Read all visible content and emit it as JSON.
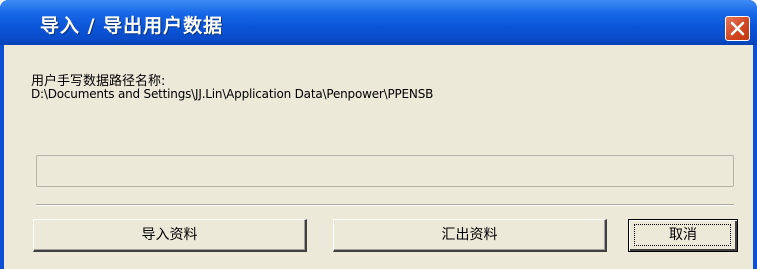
{
  "window": {
    "title": "导入 / 导出用户数据",
    "close_icon": "close-icon"
  },
  "content": {
    "path_label": "用户手写数据路径名称:",
    "path_value": "D:\\Documents and Settings\\JJ.Lin\\Application Data\\Penpower\\PPENSB",
    "progress_fraction": 0
  },
  "buttons": {
    "import_label": "导入资料",
    "export_label": "汇出资料",
    "cancel_label": "取消"
  },
  "colors": {
    "titlebar": "#0b55d8",
    "client_bg": "#ece9d8",
    "close_button": "#d24a26"
  }
}
